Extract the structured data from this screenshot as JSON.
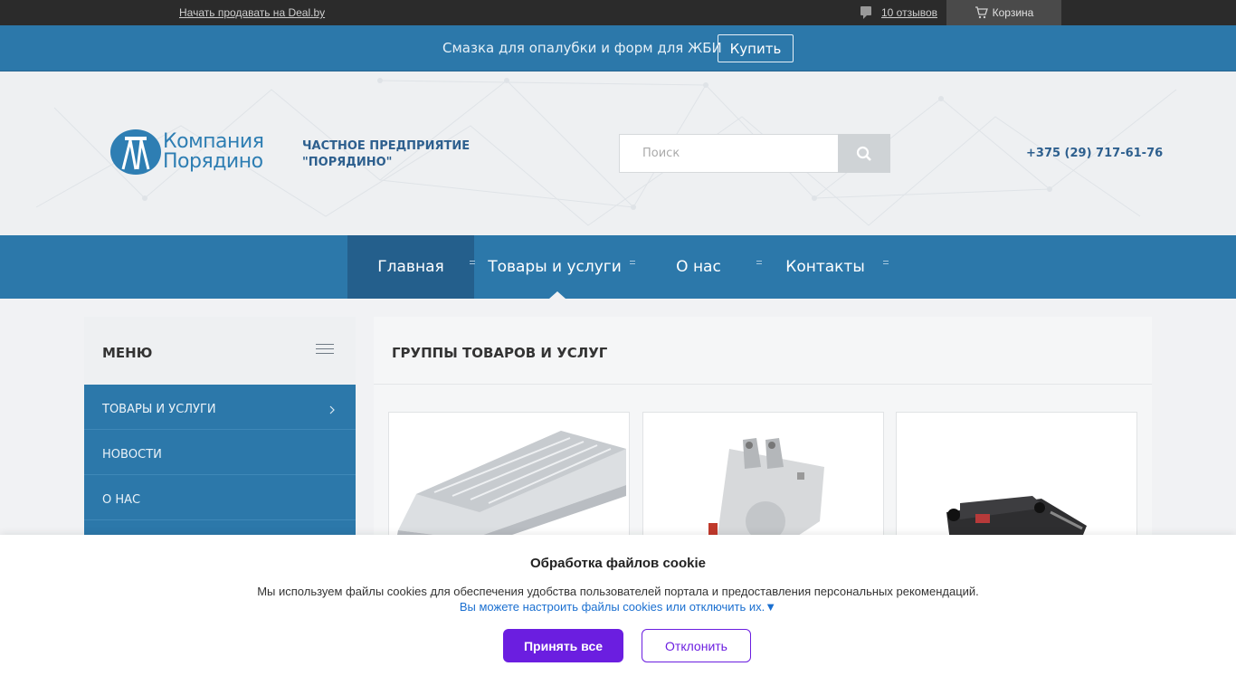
{
  "topbar": {
    "sell_link": "Начать продавать на Deal.by",
    "reviews": "10 отзывов",
    "cart": "Корзина"
  },
  "promo": {
    "text": "Смазка для опалубки и форм для ЖБИ",
    "button": "Купить"
  },
  "header": {
    "logo_line1": "Компания",
    "logo_line2": "Порядино",
    "tagline_line1": "ЧАСТНОЕ ПРЕДПРИЯТИЕ",
    "tagline_line2": "\"ПОРЯДИНО\"",
    "search_placeholder": "Поиск",
    "phone": "+375 (29) 717-61-76"
  },
  "nav": {
    "items": [
      "Главная",
      "Товары и услуги",
      "О нас",
      "Контакты"
    ]
  },
  "menu": {
    "title": "МЕНЮ",
    "items": [
      "ТОВАРЫ И УСЛУГИ",
      "НОВОСТИ",
      "О НАС",
      ""
    ]
  },
  "content": {
    "title": "ГРУППЫ ТОВАРОВ И УСЛУГ"
  },
  "cookie": {
    "title": "Обработка файлов cookie",
    "description": "Мы используем файлы cookies для обеспечения удобства пользователей портала и предоставления персональных рекомендаций.",
    "settings_link": "Вы можете настроить файлы cookies или отключить их.▼",
    "accept": "Принять все",
    "decline": "Отклонить"
  },
  "colors": {
    "brand_blue": "#2c78aa",
    "brand_blue_dark": "#245f8c",
    "accent_purple": "#6b1ee0"
  }
}
